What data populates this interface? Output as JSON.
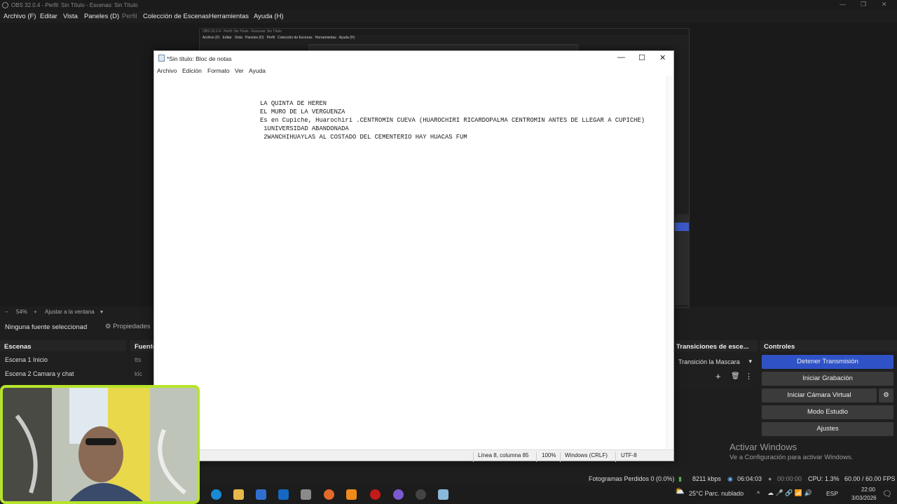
{
  "obs": {
    "title": "OBS 32.0.4 - Perfil: Sin Título - Escenas: Sin Título",
    "menu": [
      "Archivo (F)",
      "Editar",
      "Vista",
      "Paneles (D)",
      "Perfil",
      "Colección de Escenas",
      "Herramientas",
      "Ayuda (H)"
    ],
    "zoom": {
      "minus": "−",
      "value": "54%",
      "plus": "+",
      "fit": "Ajustar a la ventana"
    },
    "no_source": "Ninguna fuente seleccionad",
    "properties": "Propiedades",
    "scenes": {
      "header": "Escenas",
      "items": [
        "Escena 1 Inicio",
        "Escena 2 Camara y chat"
      ]
    },
    "sources": {
      "header": "Fuente",
      "items": [
        "tts",
        "kic"
      ]
    },
    "transitions": {
      "header": "Transiciones de esce...",
      "selected": "Transición la Mascara"
    },
    "controls": {
      "header": "Controles",
      "stop_stream": "Detener Transmisión",
      "start_record": "Iniciar Grabación",
      "start_virtual": "Iniciar Cámara Virtual",
      "studio": "Modo Estudio",
      "settings": "Ajustes"
    },
    "status": {
      "dropped": "Fotogramas Perdidos 0 (0.0%)",
      "kbps": "8211 kbps",
      "live": "06:04:03",
      "rec": "00:00:00",
      "cpu": "CPU: 1.3%",
      "fps": "60.00 / 60.00 FPS"
    }
  },
  "notepad": {
    "title": "*Sin título: Bloc de notas",
    "menu": [
      "Archivo",
      "Edición",
      "Formato",
      "Ver",
      "Ayuda"
    ],
    "lines": [
      "LA QUINTA DE HEREN",
      "EL MURO DE LA VERGUENZA",
      "Es en Cupiche, Huarochiri .CENTROMIN CUEVA (HUAROCHIRI RICARDOPALMA CENTROMIN ANTES DE LLEGAR A CUPICHE)",
      " 1UNIVERSIDAD ABANDONADA",
      " 2WANCHIHUAYLAS AL COSTADO DEL CEMENTERIO HAY HUACAS FUM"
    ],
    "status": {
      "position": "Línea 8, columna 85",
      "zoom": "100%",
      "eol": "Windows (CRLF)",
      "encoding": "UTF-8"
    }
  },
  "watermark": {
    "line1": "Activar Windows",
    "line2": "Ve a Configuración para activar Windows."
  },
  "taskbar": {
    "weather": "25°C  Parc. nublado",
    "lang": "ESP",
    "time": "22:00",
    "date": "3/03/2026"
  },
  "colors": {
    "accent": "#2f53c7",
    "webcam_border": "#b6e42a"
  }
}
